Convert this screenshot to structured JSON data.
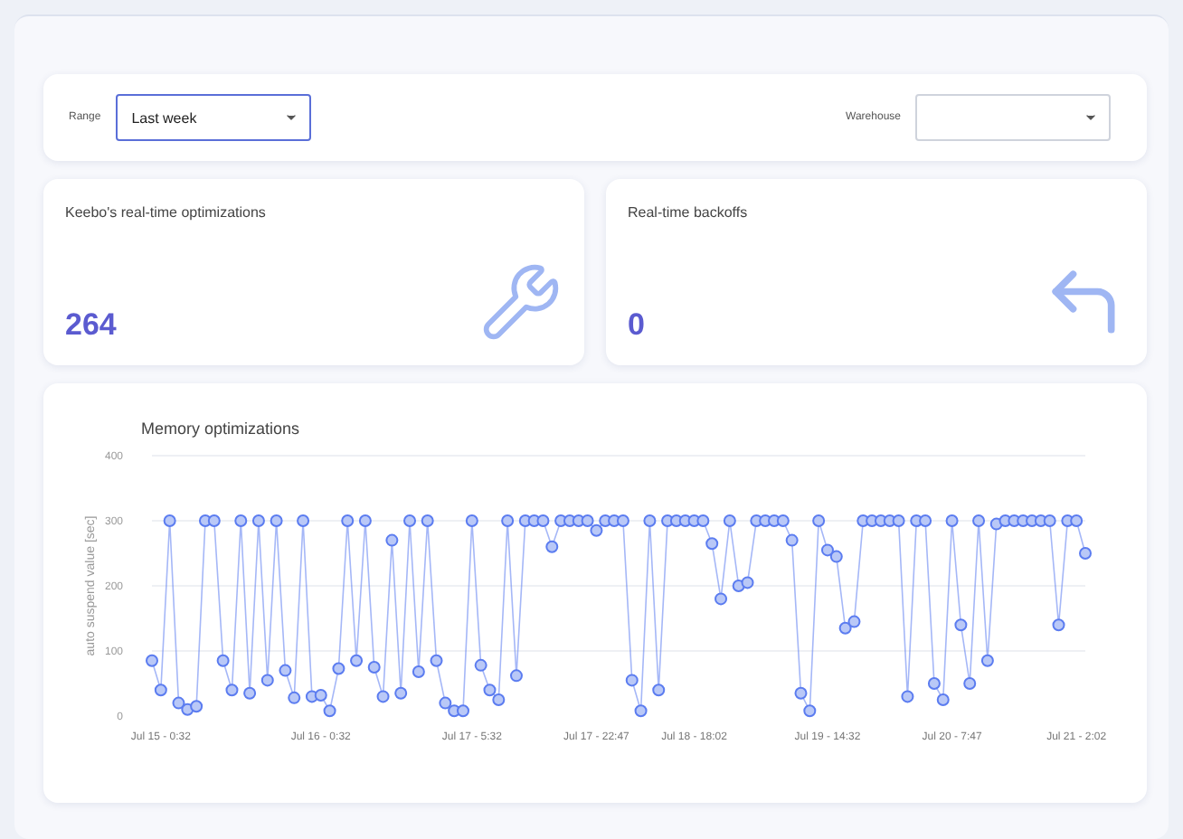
{
  "filters": [
    {
      "label": "Range",
      "value": "Last week",
      "focused": true
    },
    {
      "label": "Warehouse",
      "focused": false
    }
  ],
  "stats": [
    {
      "title": "Keebo's real-time optimizations",
      "value": "264",
      "kind": "wrench"
    },
    {
      "title": "Real-time backoffs",
      "value": "0",
      "kind": "return"
    }
  ],
  "chart": {
    "chart_data": {
      "type": "line",
      "title": "Memory optimizations",
      "ylabel": "auto suspend value [sec]",
      "ylim": [
        0,
        400
      ],
      "yticks": [
        0,
        100,
        200,
        300,
        400
      ],
      "grid": true,
      "categories": [
        null,
        "Jul 15 - 0:32",
        null,
        null,
        null,
        null,
        null,
        null,
        null,
        null,
        null,
        null,
        null,
        null,
        null,
        null,
        null,
        null,
        null,
        "Jul 16 - 0:32",
        null,
        null,
        null,
        null,
        null,
        null,
        null,
        null,
        null,
        null,
        null,
        null,
        null,
        null,
        null,
        null,
        "Jul 17 - 5:32",
        null,
        null,
        null,
        null,
        null,
        null,
        null,
        null,
        null,
        null,
        null,
        null,
        null,
        "Jul 17 - 22:47",
        null,
        null,
        null,
        null,
        null,
        null,
        null,
        null,
        null,
        null,
        "Jul 18 - 18:02",
        null,
        null,
        null,
        null,
        null,
        null,
        null,
        null,
        null,
        null,
        null,
        null,
        null,
        null,
        "Jul 19 - 14:32",
        null,
        null,
        null,
        null,
        null,
        null,
        null,
        null,
        null,
        null,
        null,
        null,
        null,
        "Jul 20 - 7:47",
        null,
        null,
        null,
        null,
        null,
        null,
        null,
        null,
        null,
        null,
        null,
        null,
        null,
        "Jul 21 - 2:02",
        null
      ],
      "series": [
        {
          "color": "#5b7cf0",
          "marker": "circle",
          "values": [
            85,
            40,
            300,
            20,
            10,
            15,
            300,
            300,
            85,
            40,
            300,
            35,
            300,
            55,
            300,
            70,
            28,
            300,
            30,
            32,
            8,
            73,
            300,
            85,
            300,
            75,
            30,
            270,
            35,
            300,
            68,
            300,
            85,
            20,
            8,
            8,
            300,
            78,
            40,
            25,
            300,
            62,
            300,
            300,
            300,
            260,
            300,
            300,
            300,
            300,
            285,
            300,
            300,
            300,
            55,
            8,
            300,
            40,
            300,
            300,
            300,
            300,
            300,
            265,
            180,
            300,
            200,
            205,
            300,
            300,
            300,
            300,
            270,
            35,
            8,
            300,
            255,
            245,
            135,
            145,
            300,
            300,
            300,
            300,
            300,
            30,
            300,
            300,
            50,
            25,
            300,
            140,
            50,
            300,
            85,
            295,
            300,
            300,
            300,
            300,
            300,
            300,
            140,
            300,
            300,
            250
          ]
        }
      ]
    }
  }
}
